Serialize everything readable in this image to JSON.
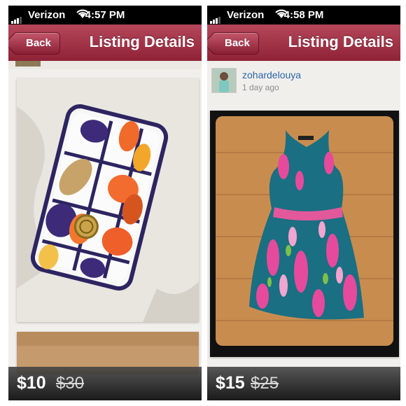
{
  "screens": [
    {
      "status": {
        "carrier": "Verizon",
        "time": "4:57 PM"
      },
      "nav": {
        "back_label": "Back",
        "title": "Listing Details"
      },
      "listing": {
        "price": "$10",
        "original_price": "$30"
      }
    },
    {
      "status": {
        "carrier": "Verizon",
        "time": "4:58 PM"
      },
      "nav": {
        "back_label": "Back",
        "title": "Listing Details"
      },
      "seller": {
        "username": "zohardelouya",
        "posted": "1 day ago"
      },
      "listing": {
        "price": "$15",
        "original_price": "$25"
      }
    }
  ],
  "colors": {
    "nav_bar": "#9a2a3f",
    "link": "#2a66a8"
  }
}
